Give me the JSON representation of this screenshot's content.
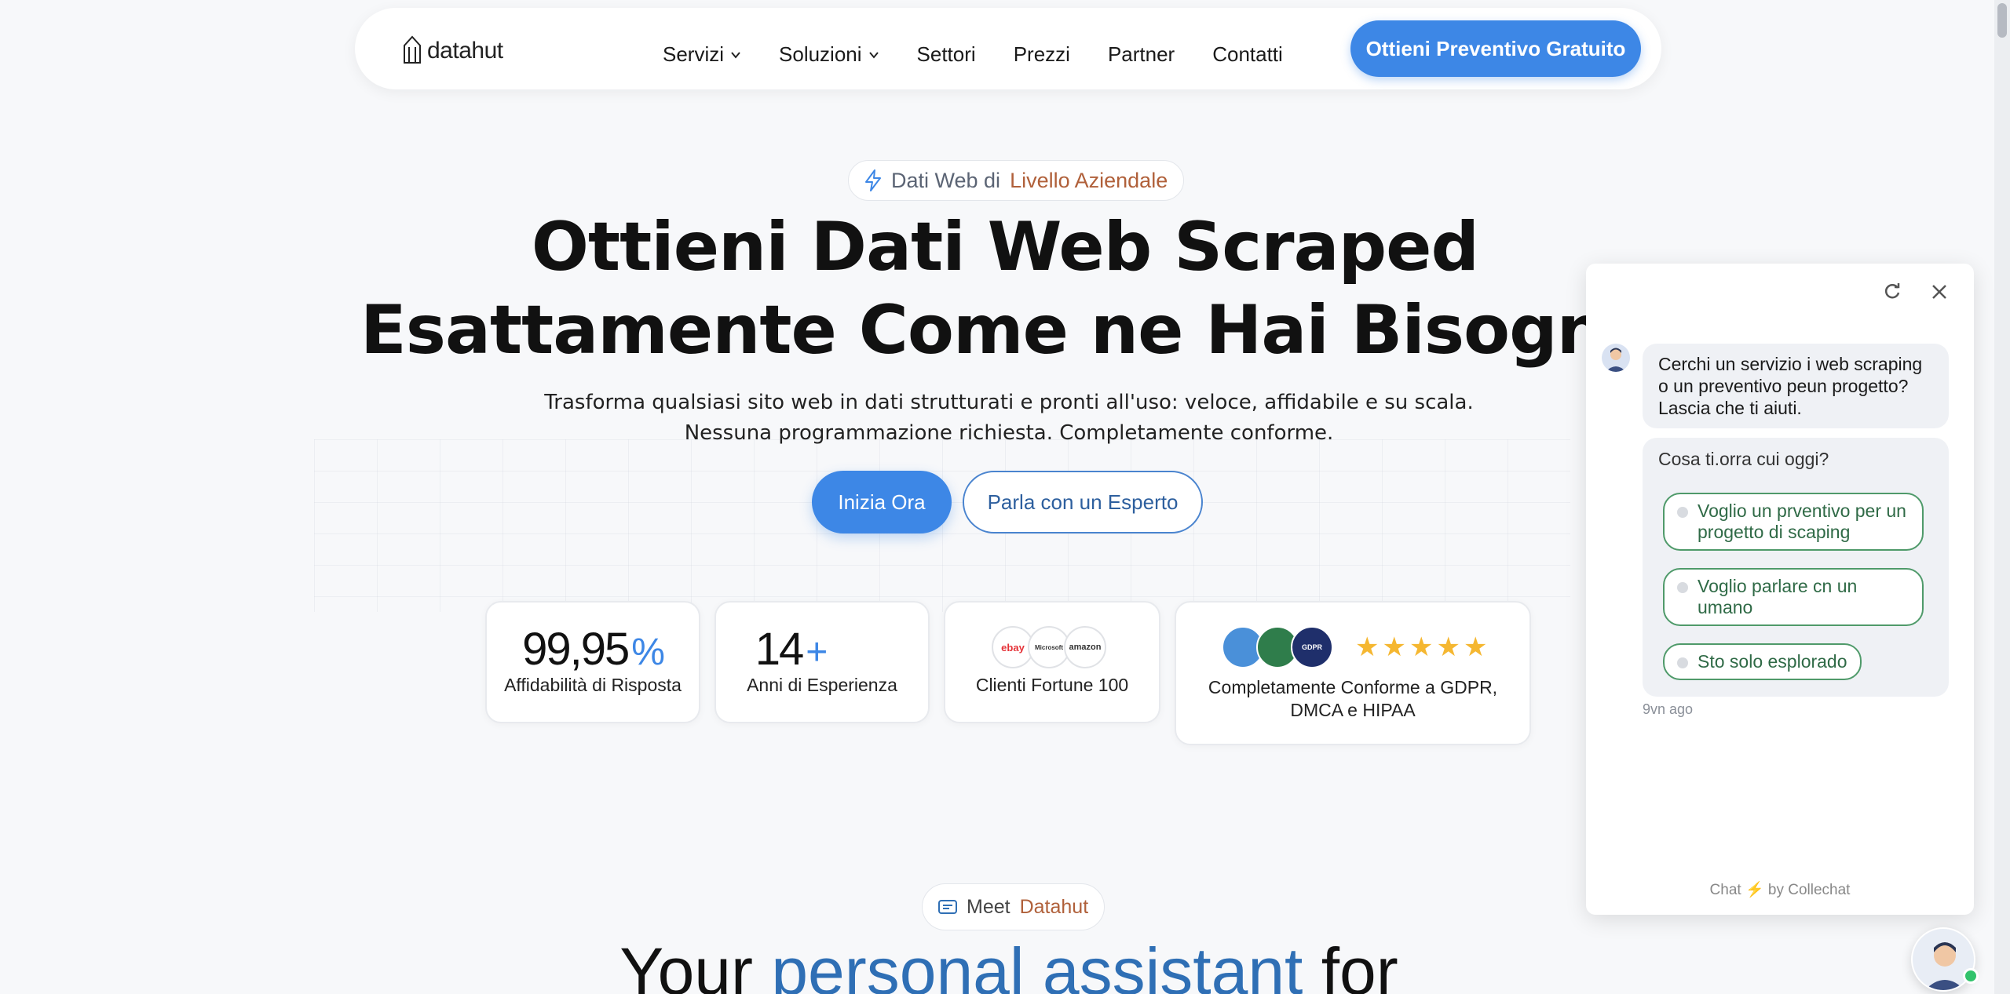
{
  "colors": {
    "accent": "#3d87e6",
    "gold_star": "#f5b731",
    "option_green": "#4f9a6a"
  },
  "nav": {
    "logo_text": "datahut",
    "links": [
      {
        "label": "Servizi",
        "has_dropdown": true
      },
      {
        "label": "Soluzioni",
        "has_dropdown": true
      },
      {
        "label": "Settori",
        "has_dropdown": false
      },
      {
        "label": "Prezzi",
        "has_dropdown": false
      },
      {
        "label": "Partner",
        "has_dropdown": false
      },
      {
        "label": "Contatti",
        "has_dropdown": false
      }
    ],
    "cta_label": "Ottieni Preventivo Gratuito"
  },
  "hero": {
    "pill_part1": "Dati Web di",
    "pill_part2": "Livello Aziendale",
    "headline_line1": "Ottieni Dati Web Scraped",
    "headline_line2": "Esattamente Come ne Hai Bisogno",
    "sub_line1": "Trasforma qualsiasi sito web in dati strutturati e pronti all'uso: veloce, affidabile e su scala.",
    "sub_line2": "Nessuna programmazione richiesta. Completamente conforme.",
    "primary_button": "Inizia Ora",
    "secondary_button": "Parla con un Esperto"
  },
  "stats": {
    "reliability_value": "99,95",
    "reliability_unit": "%",
    "reliability_label": "Affidabilità di Risposta",
    "experience_value": "14",
    "experience_unit": "+",
    "experience_label": "Anni di Esperienza",
    "clients_logos": [
      "ebay",
      "Microsoft",
      "amazon"
    ],
    "clients_label": "Clienti Fortune 100",
    "compliance_badges": [
      "globe-badge",
      "shield-badge",
      "gdpr-badge"
    ],
    "compliance_badge_gdpr_text": "GDPR",
    "compliance_stars": 5,
    "compliance_label_line1": "Completamente Conforme a GDPR,",
    "compliance_label_line2": "DMCA e HIPAA"
  },
  "meet": {
    "part1": "Meet",
    "part2": "Datahut",
    "title_part1": "Your",
    "title_part2": "personal assistant",
    "title_part3": "for"
  },
  "chat": {
    "greeting_line1": "Cerchi un servizio i web scraping",
    "greeting_line2": "o un preventivo peun progetto?",
    "greeting_line3": "Lascia che ti aiuti.",
    "question": "Cosa ti.orra cui oggi?",
    "option1_line1": "Voglio un prventivo per un",
    "option1_line2": "progetto di scaping",
    "option2_line1": "Voglio parlare cn un",
    "option2_line2": "umano",
    "option3": "Sto solo esplorado",
    "timestamp": "9vn ago",
    "powered_prefix": "Chat",
    "powered_suffix": "by Collechat"
  }
}
